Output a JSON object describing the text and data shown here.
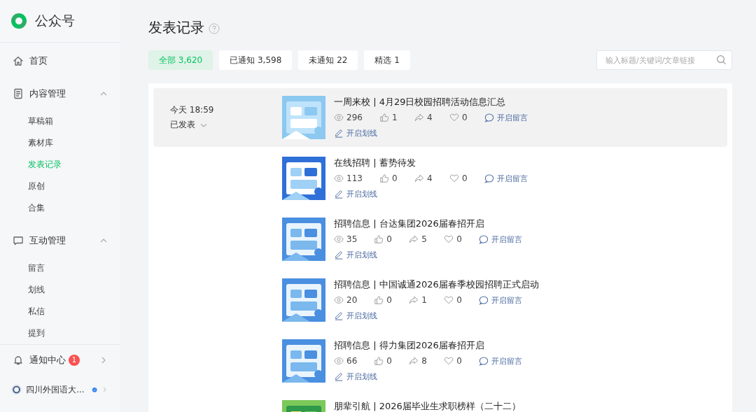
{
  "logo": {
    "text": "公众号"
  },
  "sidebar": {
    "items": [
      {
        "kind": "link",
        "label": "首页",
        "selected": false
      },
      {
        "kind": "group",
        "label": "内容管理",
        "expanded": true,
        "children": [
          {
            "label": "草稿箱",
            "selected": false
          },
          {
            "label": "素材库",
            "selected": false
          },
          {
            "label": "发表记录",
            "selected": true
          },
          {
            "label": "原创",
            "selected": false
          },
          {
            "label": "合集",
            "selected": false
          }
        ]
      },
      {
        "kind": "group",
        "label": "互动管理",
        "expanded": true,
        "children": [
          {
            "label": "留言",
            "selected": false
          },
          {
            "label": "划线",
            "selected": false
          },
          {
            "label": "私信",
            "selected": false
          },
          {
            "label": "提到",
            "selected": false
          }
        ]
      }
    ],
    "notification": {
      "label": "通知中心",
      "badge": "1"
    },
    "account": {
      "name": "四川外国语大...",
      "verified": true
    }
  },
  "page_title": "发表记录",
  "filters": [
    {
      "label": "全部 3,620",
      "selected": true
    },
    {
      "label": "已通知 3,598",
      "selected": false
    },
    {
      "label": "未通知 22",
      "selected": false
    },
    {
      "label": "精选 1",
      "selected": false
    }
  ],
  "search": {
    "placeholder": "输入标题/关键词/文章链接"
  },
  "articles": [
    {
      "highlighted": true,
      "time": "今天 18:59",
      "status": "已发表",
      "title": "一周来校 | 4月29日校园招聘活动信息汇总",
      "views": "296",
      "likes": "1",
      "shares": "4",
      "favorites": "0",
      "comment_label": "开启留言",
      "underline_label": "开启划线"
    },
    {
      "highlighted": false,
      "title": "在线招聘 | 蓄势待发",
      "views": "113",
      "likes": "0",
      "shares": "4",
      "favorites": "0",
      "comment_label": "开启留言",
      "underline_label": "开启划线"
    },
    {
      "highlighted": false,
      "title": "招聘信息 | 台达集团2026届春招开启",
      "views": "35",
      "likes": "0",
      "shares": "5",
      "favorites": "0",
      "comment_label": "开启留言",
      "underline_label": "开启划线"
    },
    {
      "highlighted": false,
      "title": "招聘信息 | 中国诚通2026届春季校园招聘正式启动",
      "views": "20",
      "likes": "0",
      "shares": "1",
      "favorites": "0",
      "comment_label": "开启留言",
      "underline_label": "开启划线"
    },
    {
      "highlighted": false,
      "title": "招聘信息 | 得力集团2026届春招开启",
      "views": "66",
      "likes": "0",
      "shares": "8",
      "favorites": "0",
      "comment_label": "开启留言",
      "underline_label": "开启划线"
    },
    {
      "highlighted": false,
      "title": "朋辈引航 | 2026届毕业生求职榜样（二十二）"
    }
  ]
}
